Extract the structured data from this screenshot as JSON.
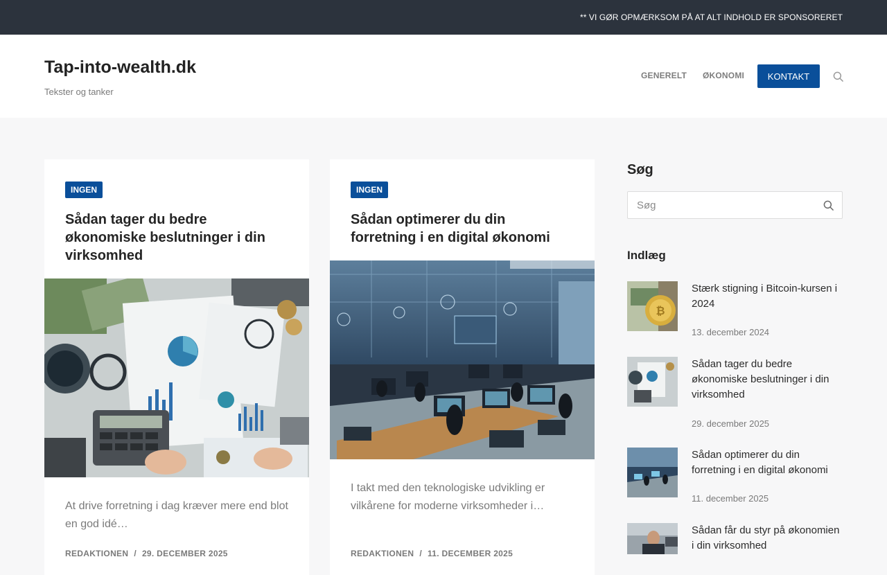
{
  "topbar": {
    "notice": "** VI GØR OPMÆRKSOM PÅ AT ALT INDHOLD ER SPONSORERET"
  },
  "header": {
    "site_title": "Tap-into-wealth.dk",
    "tagline": "Tekster og tanker",
    "nav": [
      {
        "label": "GENERELT"
      },
      {
        "label": "ØKONOMI"
      },
      {
        "label": "KONTAKT"
      }
    ],
    "search_icon": "search-icon"
  },
  "articles": [
    {
      "category": "INGEN",
      "title": "Sådan tager du bedre økonomiske beslutninger i din virksomhed",
      "excerpt": "At drive forretning i dag kræver mere end blot en god idé…",
      "author": "REDAKTIONEN",
      "date": "29. DECEMBER 2025"
    },
    {
      "category": "INGEN",
      "title": "Sådan optimerer du din forretning i en digital økonomi",
      "excerpt": "I takt med den teknologiske udvikling er vilkårene for moderne virksomheder i…",
      "author": "REDAKTIONEN",
      "date": "11. DECEMBER 2025"
    }
  ],
  "sidebar": {
    "search_heading": "Søg",
    "search_placeholder": "Søg",
    "posts_heading": "Indlæg",
    "posts": [
      {
        "title": "Stærk stigning i Bitcoin-kursen i 2024",
        "date": "13. december 2024"
      },
      {
        "title": "Sådan tager du bedre økonomiske beslutninger i din virksomhed",
        "date": "29. december 2025"
      },
      {
        "title": "Sådan optimerer du din forretning i en digital økonomi",
        "date": "11. december 2025"
      },
      {
        "title": "Sådan får du styr på økonomien i din virksomhed",
        "date": ""
      }
    ]
  },
  "colors": {
    "topbar_bg": "#2c333d",
    "accent": "#0a4f9a",
    "page_bg": "#f7f7f8"
  }
}
